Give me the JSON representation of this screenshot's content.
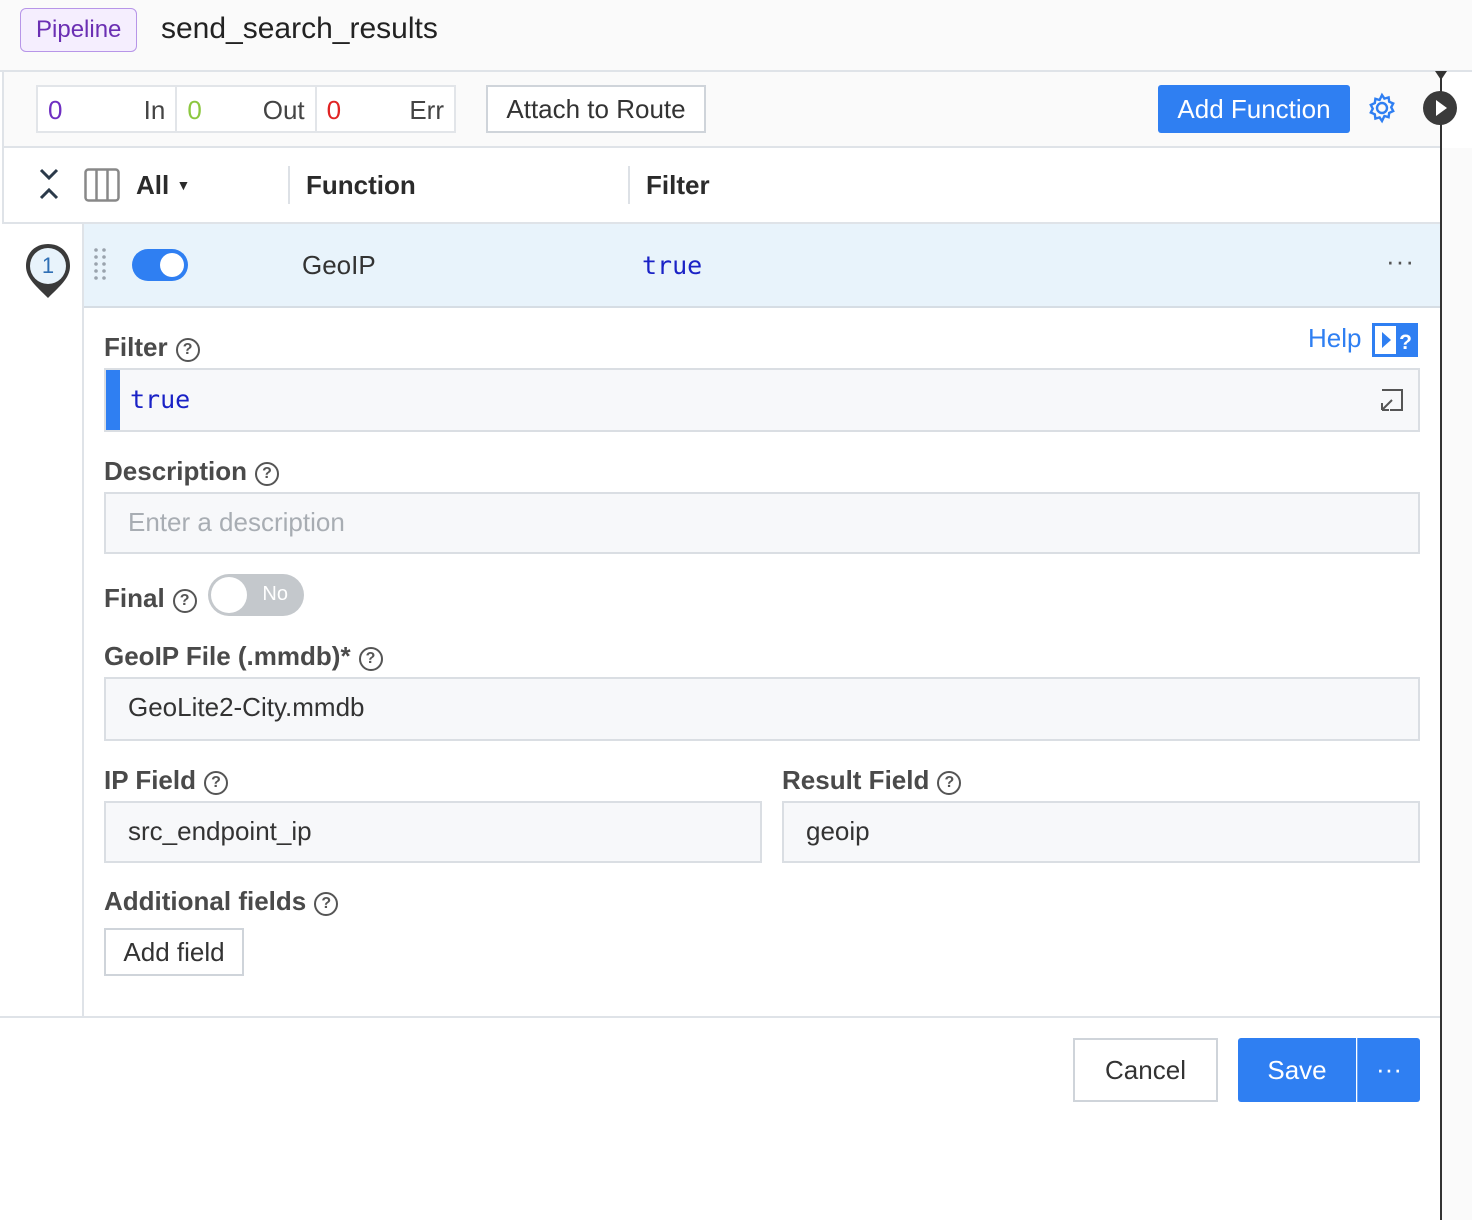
{
  "header": {
    "badge": "Pipeline",
    "title": "send_search_results"
  },
  "toolbar": {
    "stats": [
      {
        "value": "0",
        "label": "In",
        "color": "#6f2fc2"
      },
      {
        "value": "0",
        "label": "Out",
        "color": "#8cc73f"
      },
      {
        "value": "0",
        "label": "Err",
        "color": "#e02424"
      }
    ],
    "attach_label": "Attach to Route",
    "add_function_label": "Add Function"
  },
  "columns": {
    "filter_dropdown": "All",
    "function": "Function",
    "filter": "Filter"
  },
  "function_row": {
    "index": "1",
    "name": "GeoIP",
    "filter": "true",
    "enabled": true,
    "more": "···"
  },
  "form": {
    "help_label": "Help",
    "filter": {
      "label": "Filter",
      "value": "true"
    },
    "description": {
      "label": "Description",
      "placeholder": "Enter a description",
      "value": ""
    },
    "final": {
      "label": "Final",
      "state": "No"
    },
    "geoip_file": {
      "label": "GeoIP File (.mmdb)*",
      "value": "GeoLite2-City.mmdb"
    },
    "ip_field": {
      "label": "IP Field",
      "value": "src_endpoint_ip"
    },
    "result_field": {
      "label": "Result Field",
      "value": "geoip"
    },
    "additional_fields": {
      "label": "Additional fields",
      "add_label": "Add field"
    }
  },
  "footer": {
    "cancel_label": "Cancel",
    "save_label": "Save",
    "more_label": "···"
  },
  "colors": {
    "accent": "#2f7ff2",
    "row_highlight": "#e8f3fb"
  }
}
